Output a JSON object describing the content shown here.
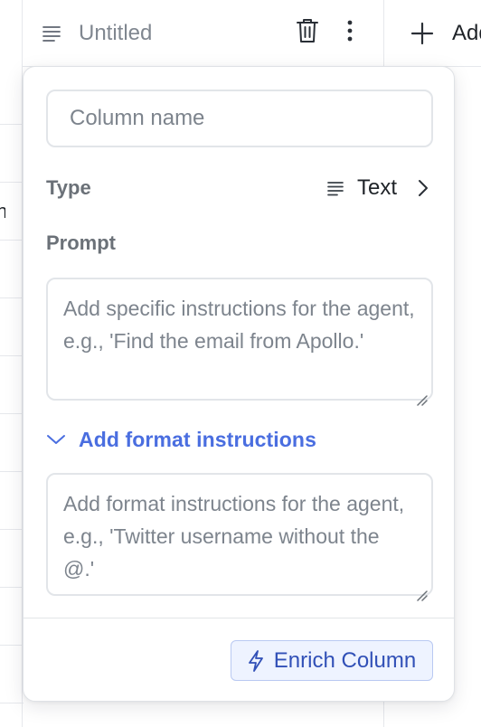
{
  "header": {
    "column_title": "Untitled",
    "add_column_label": "Add",
    "type_icon": "text-lines-icon",
    "delete_icon": "trash-icon",
    "menu_icon": "more-vertical-icon",
    "add_icon": "plus-icon"
  },
  "background": {
    "cell_fragment": "n"
  },
  "popover": {
    "column_name": {
      "value": "",
      "placeholder": "Column name"
    },
    "type": {
      "label": "Type",
      "value": "Text",
      "icon": "text-lines-icon",
      "chevron": "chevron-right-icon"
    },
    "prompt": {
      "label": "Prompt",
      "placeholder": "Add specific instructions for the agent, e.g., 'Find the email from Apollo.'"
    },
    "format": {
      "toggle_label": "Add format instructions",
      "toggle_icon": "chevron-down-icon",
      "placeholder": "Add format instructions for the agent, e.g., 'Twitter username without the @.'"
    },
    "enrich_button": {
      "label": "Enrich Column",
      "icon": "lightning-bolt-icon"
    }
  },
  "colors": {
    "accent": "#4a6ee0",
    "button_bg": "#eef3ff",
    "button_border": "#b9c9f2",
    "button_text": "#3150b7",
    "muted_text": "#7d848d",
    "label_text": "#6b7178"
  }
}
